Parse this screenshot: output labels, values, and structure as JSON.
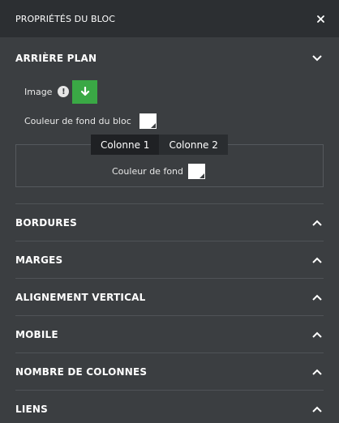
{
  "header": {
    "title": "PROPRIÉTÉS DU BLOC",
    "close_icon": "close-icon"
  },
  "background": {
    "title": "ARRIÈRE PLAN",
    "image_label": "Image",
    "block_color_label": "Couleur de fond du bloc",
    "tabs": [
      {
        "label": "Colonne 1"
      },
      {
        "label": "Colonne 2"
      }
    ],
    "column_color_label": "Couleur de fond",
    "download_color": "#3aa845"
  },
  "sections": [
    {
      "label": "BORDURES"
    },
    {
      "label": "MARGES"
    },
    {
      "label": "ALIGNEMENT VERTICAL"
    },
    {
      "label": "MOBILE"
    },
    {
      "label": "NOMBRE DE COLONNES"
    },
    {
      "label": "LIENS"
    }
  ]
}
